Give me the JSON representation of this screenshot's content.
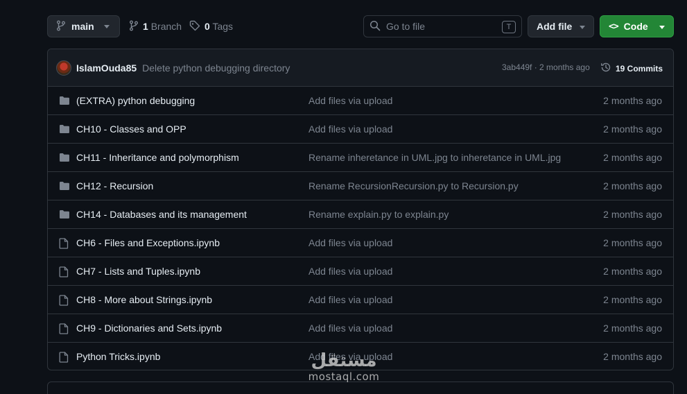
{
  "toolbar": {
    "branch_name": "main",
    "branch_count": "1",
    "branch_label": "Branch",
    "tag_count": "0",
    "tag_label": "Tags",
    "goto_placeholder": "Go to file",
    "goto_shortcut": "T",
    "add_file_label": "Add file",
    "code_label": "Code"
  },
  "latest_commit": {
    "author": "IslamOuda85",
    "message": "Delete python debugging directory",
    "info": "3ab449f · 2 months ago",
    "commits_label": "19 Commits"
  },
  "files": [
    {
      "type": "folder",
      "name": "(EXTRA) python debugging",
      "message": "Add files via upload",
      "date": "2 months ago"
    },
    {
      "type": "folder",
      "name": "CH10 - Classes and OPP",
      "message": "Add files via upload",
      "date": "2 months ago"
    },
    {
      "type": "folder",
      "name": "CH11 - Inheritance and polymorphism",
      "message": "Rename inheretance in UML.jpg to inheretance in UML.jpg",
      "date": "2 months ago"
    },
    {
      "type": "folder",
      "name": "CH12 - Recursion",
      "message": "Rename RecursionRecursion.py to Recursion.py",
      "date": "2 months ago"
    },
    {
      "type": "folder",
      "name": "CH14 - Databases and its management",
      "message": "Rename explain.py to explain.py",
      "date": "2 months ago"
    },
    {
      "type": "file",
      "name": "CH6 - Files and Exceptions.ipynb",
      "message": "Add files via upload",
      "date": "2 months ago"
    },
    {
      "type": "file",
      "name": "CH7 - Lists and Tuples.ipynb",
      "message": "Add files via upload",
      "date": "2 months ago"
    },
    {
      "type": "file",
      "name": "CH8 - More about Strings.ipynb",
      "message": "Add files via upload",
      "date": "2 months ago"
    },
    {
      "type": "file",
      "name": "CH9 - Dictionaries and Sets.ipynb",
      "message": "Add files via upload",
      "date": "2 months ago"
    },
    {
      "type": "file",
      "name": "Python Tricks.ipynb",
      "message": "Add files via upload",
      "date": "2 months ago"
    }
  ],
  "watermark": {
    "arabic": "مستقل",
    "latin": "mostaql.com"
  },
  "colors": {
    "background": "#0d1117",
    "border": "#30363d",
    "muted_text": "#7d8590",
    "icon": "#7d8590",
    "code_button": "#238636"
  },
  "icons": {
    "branch": "git-branch-icon",
    "tag": "tag-icon",
    "search": "search-icon",
    "code": "code-icon",
    "history": "history-icon",
    "folder": "folder-icon",
    "file": "file-icon"
  }
}
